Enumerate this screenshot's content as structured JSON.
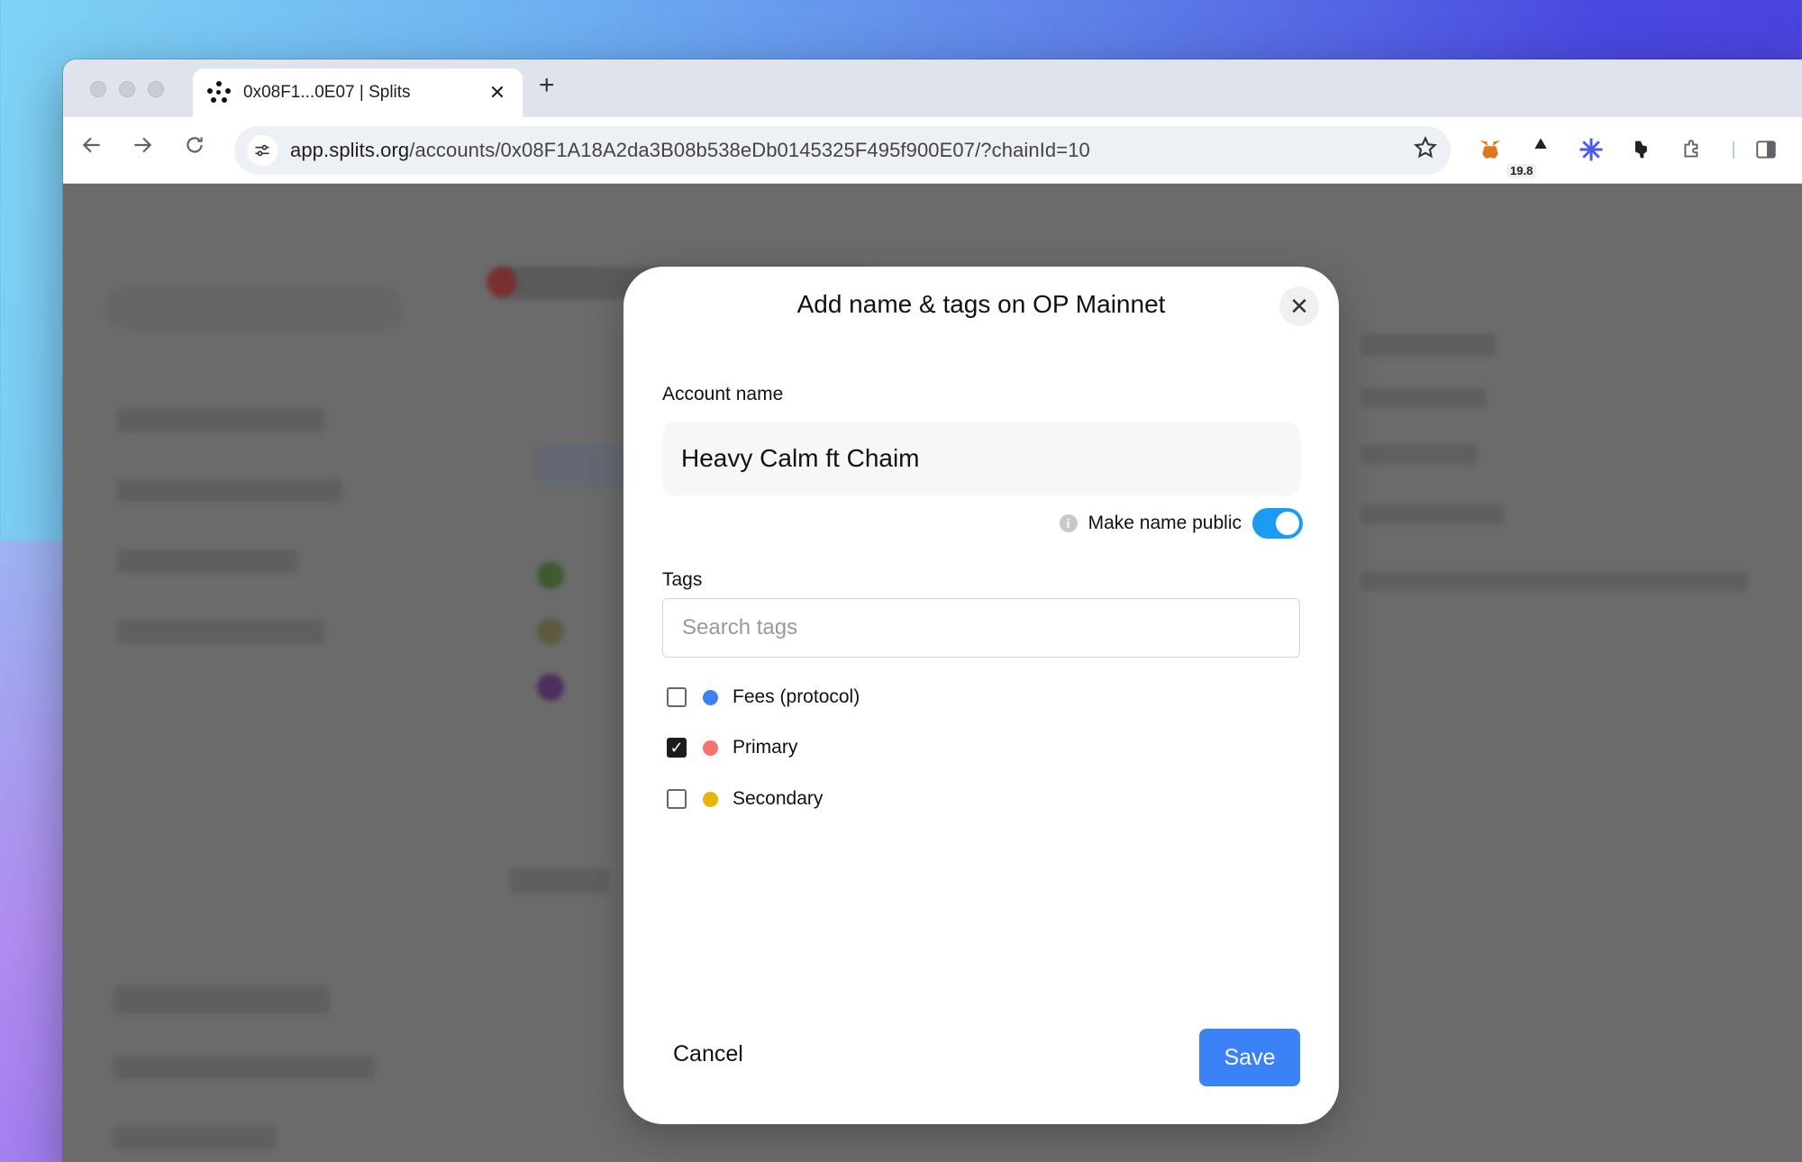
{
  "browser": {
    "tab_title": "0x08F1...0E07 | Splits",
    "tab_close": "✕",
    "new_tab": "+",
    "url_host": "app.splits.org",
    "url_path": "/accounts/0x08F1A18A2da3B08b538eDb0145325F495f900E07/?chainId=10",
    "extension_badge": "19.8",
    "icons": [
      "back-icon",
      "forward-icon",
      "reload-icon",
      "site-settings-icon",
      "bookmark-star-icon",
      "metamask-icon",
      "extension-icon",
      "extensions-puzzle-icon",
      "side-panel-icon"
    ]
  },
  "modal": {
    "title": "Add name & tags on OP Mainnet",
    "close_symbol": "✕",
    "account_name_label": "Account name",
    "account_name_value": "Heavy Calm ft Chaim",
    "make_public_label": "Make name public",
    "make_public_on": true,
    "info_symbol": "i",
    "tags_label": "Tags",
    "search_placeholder": "Search tags",
    "tags": [
      {
        "label": "Fees (protocol)",
        "color": "#3b82f6",
        "checked": false
      },
      {
        "label": "Primary",
        "color": "#f87171",
        "checked": true
      },
      {
        "label": "Secondary",
        "color": "#eab308",
        "checked": false
      }
    ],
    "cancel_label": "Cancel",
    "save_label": "Save"
  }
}
